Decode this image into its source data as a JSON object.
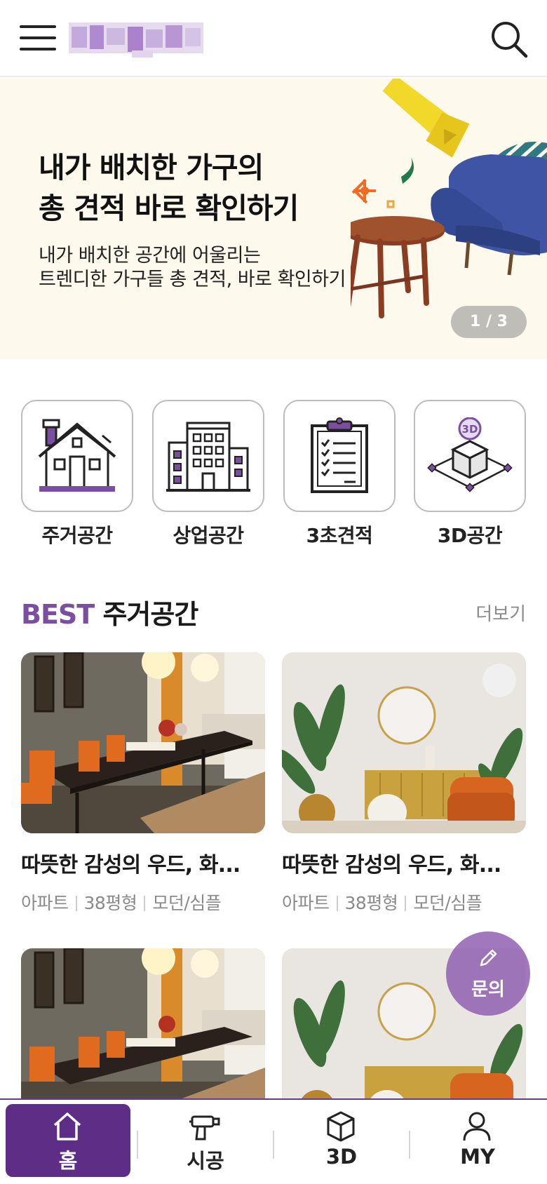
{
  "header": {
    "menu_icon": "hamburger-menu-icon",
    "search_icon": "search-icon",
    "logo_label": "blurred-logo"
  },
  "banner": {
    "title_line1": "내가 배치한 가구의",
    "title_line2": "총 견적 바로 확인하기",
    "subtitle_line1": "내가 배치한 공간에 어울리는",
    "subtitle_line2": "트렌디한 가구들 총 견적, 바로 확인하기",
    "pager": "1 / 3",
    "bg_color": "#fdf9ec"
  },
  "categories": [
    {
      "label": "주거공간",
      "icon": "house-icon"
    },
    {
      "label": "상업공간",
      "icon": "building-icon"
    },
    {
      "label": "3초견적",
      "icon": "clipboard-checklist-icon"
    },
    {
      "label": "3D공간",
      "icon": "3d-box-icon",
      "badge": "3D"
    }
  ],
  "section": {
    "title_accent": "BEST",
    "title_rest": " 주거공간",
    "more_label": "더보기",
    "accent_color": "#7b4fa0"
  },
  "cards": [
    {
      "title": "따뜻한 감성의 우드, 화...",
      "meta": [
        "아파트",
        "38평형",
        "모던/심플"
      ],
      "image": "dining-room-photo"
    },
    {
      "title": "따뜻한 감성의 우드, 화...",
      "meta": [
        "아파트",
        "38평형",
        "모던/심플"
      ],
      "image": "living-room-plants-photo"
    },
    {
      "image": "dining-room-photo"
    },
    {
      "image": "living-room-plants-photo"
    }
  ],
  "fab": {
    "label": "문의",
    "icon": "pencil-icon"
  },
  "bottom_nav": {
    "items": [
      {
        "label": "홈",
        "icon": "home-icon",
        "active": true
      },
      {
        "label": "시공",
        "icon": "drill-icon",
        "active": false
      },
      {
        "label": "3D",
        "icon": "cube-icon",
        "active": false
      },
      {
        "label": "MY",
        "icon": "user-icon",
        "active": false
      }
    ],
    "active_color": "#5e2d85"
  }
}
